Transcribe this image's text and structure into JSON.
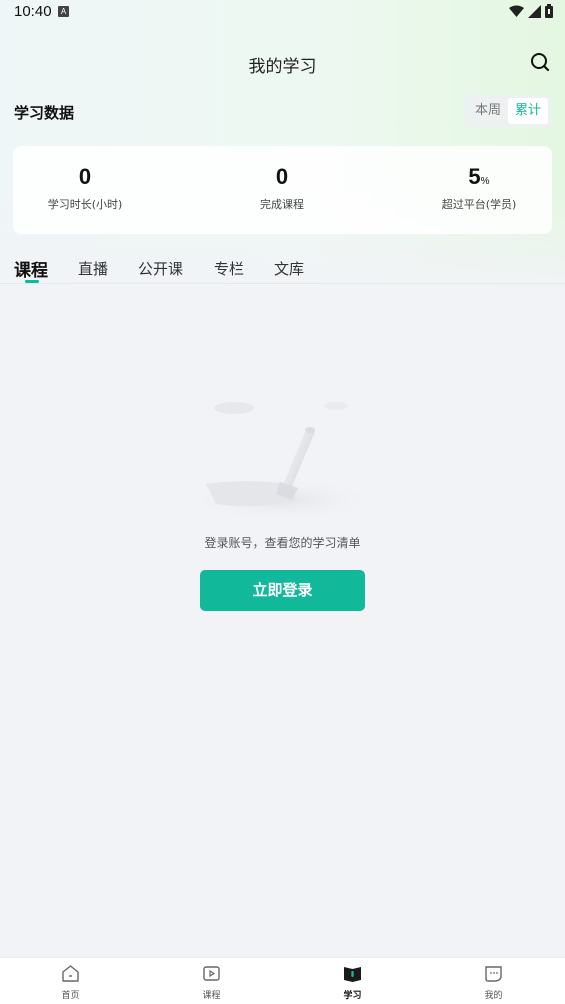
{
  "status_bar": {
    "time": "10:40",
    "notification_glyph": "A"
  },
  "header": {
    "title": "我的学习",
    "search_icon": "search-icon"
  },
  "study_data": {
    "title": "学习数据",
    "range_options": [
      "本周",
      "累计"
    ],
    "selected_range": "累计",
    "stats": [
      {
        "value": "0",
        "unit": "",
        "label": "学习时长(小时)"
      },
      {
        "value": "0",
        "unit": "",
        "label": "完成课程"
      },
      {
        "value": "5",
        "unit": "%",
        "label": "超过平台(学员)"
      }
    ]
  },
  "tabs": [
    "课程",
    "直播",
    "公开课",
    "专栏",
    "文库"
  ],
  "active_tab": "课程",
  "empty_state": {
    "message": "登录账号，查看您的学习清单",
    "button_label": "立即登录"
  },
  "bottom_nav": [
    {
      "label": "首页",
      "icon": "home-icon"
    },
    {
      "label": "课程",
      "icon": "play-icon"
    },
    {
      "label": "学习",
      "icon": "book-icon",
      "active": true
    },
    {
      "label": "我的",
      "icon": "chat-face-icon"
    }
  ],
  "colors": {
    "accent": "#12b89a",
    "background": "#f2f3f7"
  }
}
